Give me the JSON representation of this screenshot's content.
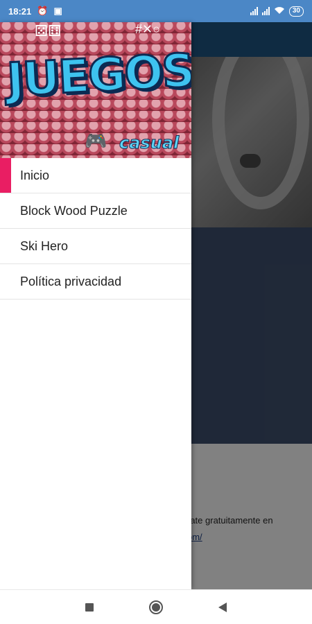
{
  "status_bar": {
    "time": "18:21",
    "battery": "30",
    "icons": [
      "alarm-icon",
      "notification-icon",
      "signal-icon",
      "signal-icon",
      "wifi-icon",
      "battery-icon"
    ]
  },
  "drawer": {
    "header": {
      "logo_title": "JUEGOS",
      "logo_subtitle": "casual"
    },
    "items": [
      {
        "label": "Inicio",
        "selected": true
      },
      {
        "label": "Block Wood Puzzle",
        "selected": false
      },
      {
        "label": "Ski Hero",
        "selected": false
      },
      {
        "label": "Política privacidad",
        "selected": false
      }
    ],
    "accent": "#e91e63"
  },
  "background_page": {
    "text": "rate gratuitamente en",
    "link": "om/"
  },
  "nav_bar": {
    "buttons": [
      "recents-square-icon",
      "home-circle-icon",
      "back-triangle-icon"
    ]
  },
  "colors": {
    "status_bar": "#4b87c6",
    "app_bar": "#1d4f78"
  }
}
